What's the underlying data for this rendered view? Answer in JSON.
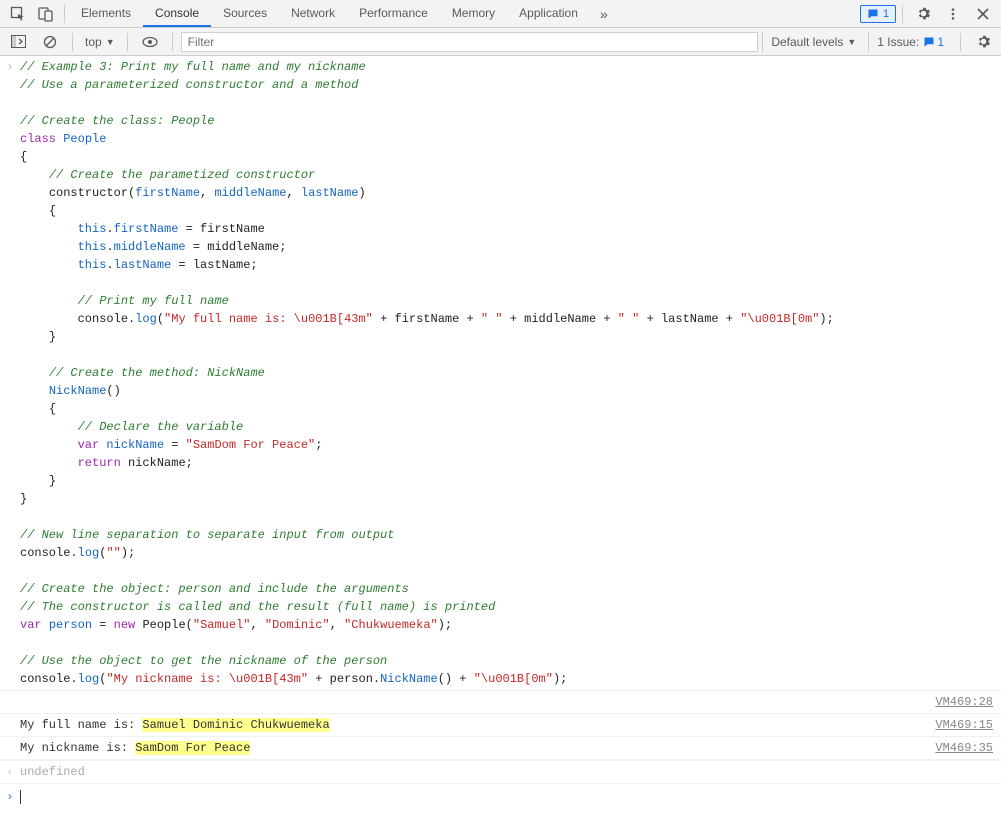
{
  "tabs": {
    "elements": "Elements",
    "console": "Console",
    "sources": "Sources",
    "network": "Network",
    "performance": "Performance",
    "memory": "Memory",
    "application": "Application"
  },
  "badge_count": "1",
  "sub": {
    "context": "top",
    "filter_placeholder": "Filter",
    "levels": "Default levels",
    "issues_label": "1 Issue:",
    "issues_count": "1"
  },
  "src": {
    "block": "VM469:28",
    "out1": "VM469:15",
    "out2": "VM469:35"
  },
  "out": {
    "line1_prefix": "My full name is: ",
    "line1_hl": "Samuel Dominic Chukwuemeka",
    "line2_prefix": "My nickname is: ",
    "line2_hl": "SamDom For Peace"
  },
  "undef": "undefined",
  "code": {
    "c1": "// Example 3: Print my full name and my nickname",
    "c2": "// Use a parameterized constructor and a method",
    "c3": "// Create the class: People",
    "kw_class": "class",
    "cls_people": "People",
    "lbrace": "{",
    "c4": "// Create the parametized constructor",
    "ctor": "constructor",
    "p_first": "firstName",
    "p_middle": "middleName",
    "p_last": "lastName",
    "kw_this": "this",
    "prop_first": "firstName",
    "prop_middle": "middleName",
    "prop_last": "lastName",
    "c5": "// Print my full name",
    "console": "console",
    "log": "log",
    "s_full": "\"My full name is: \\u001B[43m\"",
    "s_sp": "\" \"",
    "s_reset": "\"\\u001B[0m\"",
    "rbrace": "}",
    "c6": "// Create the method: NickName",
    "nick": "NickName",
    "c7": "// Declare the variable",
    "kw_var": "var",
    "v_nick": "nickName",
    "s_nick": "\"SamDom For Peace\"",
    "kw_return": "return",
    "c8": "// New line separation to separate input from output",
    "s_empty": "\"\"",
    "c9": "// Create the object: person and include the arguments",
    "c10": "// The constructor is called and the result (full name) is printed",
    "v_person": "person",
    "kw_new": "new",
    "s_sam": "\"Samuel\"",
    "s_dom": "\"Dominic\"",
    "s_chu": "\"Chukwuemeka\"",
    "c11": "// Use the object to get the nickname of the person",
    "s_nickis": "\"My nickname is: \\u001B[43m\""
  }
}
